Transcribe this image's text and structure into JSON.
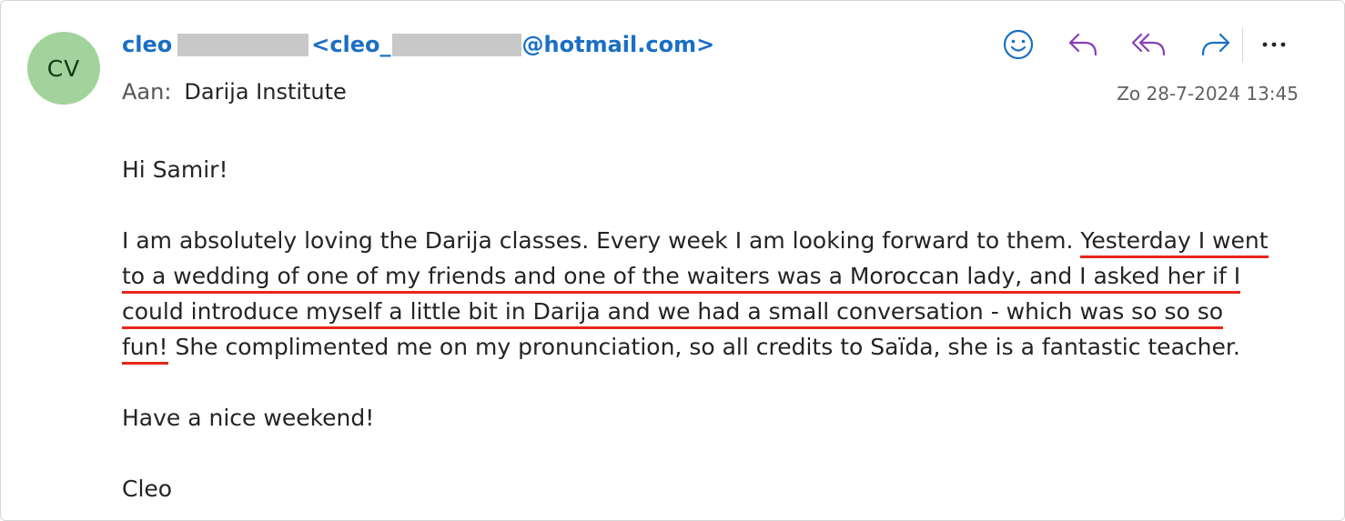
{
  "email": {
    "avatar_initials": "CV",
    "sender_name": "cleo",
    "sender_email_prefix": "<cleo_",
    "sender_email_suffix": "@hotmail.com>",
    "to_label": "Aan:",
    "to_value": "Darija Institute",
    "date": "Zo 28-7-2024 13:45"
  },
  "toolbar": {
    "icons": [
      "smiley-icon",
      "reply-icon",
      "reply-all-icon",
      "forward-icon",
      "more-icon"
    ]
  },
  "body": {
    "greeting": "Hi Samir!",
    "p1_line1_plain": "I am absolutely loving the Darija classes. Every week I am looking forward to them. ",
    "p1_line1_underlined": "Yesterday I went",
    "p1_line2_underlined": "to a wedding of one of my friends and one of the waiters was a Moroccan lady, and I asked her if I",
    "p1_line3_underlined": "could introduce myself a little bit in Darija and we had a small conversation - which was so so so",
    "p1_line4_underlined": "fun!",
    "p1_line4_plain": " She complimented me on my pronunciation, so all credits to Saïda, she is a fantastic teacher.",
    "closing": "Have a nice weekend!",
    "signature": "Cleo"
  },
  "colors": {
    "accent": "#1a6fc4",
    "purple": "#8a3db6",
    "underline": "#e8261a",
    "avatar_bg": "#a3d39c"
  }
}
